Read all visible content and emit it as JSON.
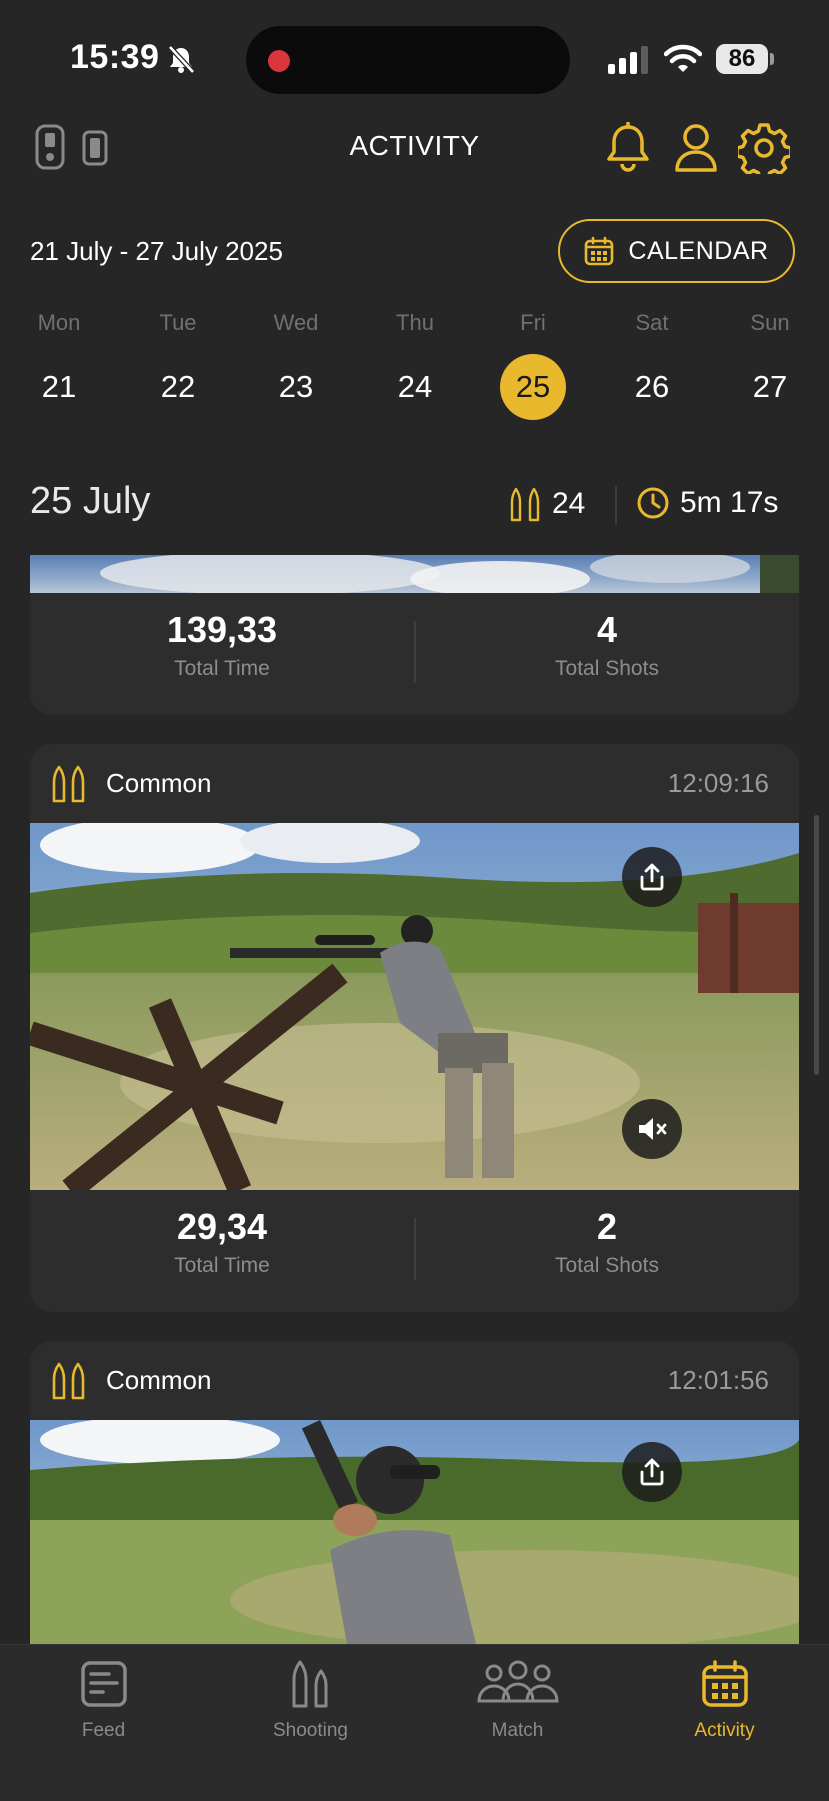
{
  "status_bar": {
    "time": "15:39",
    "battery": "86"
  },
  "header": {
    "title": "ACTIVITY"
  },
  "date_range": "21 July - 27 July 2025",
  "calendar_button": {
    "label": "CALENDAR"
  },
  "week": {
    "day_names": [
      "Mon",
      "Tue",
      "Wed",
      "Thu",
      "Fri",
      "Sat",
      "Sun"
    ],
    "dates": [
      "21",
      "22",
      "23",
      "24",
      "25",
      "26",
      "27"
    ],
    "selected": "25"
  },
  "day_summary": {
    "date": "25 July",
    "shots": "24",
    "duration": "5m 17s"
  },
  "sessions": [
    {
      "total_time": "139,33",
      "total_time_label": "Total Time",
      "total_shots": "4",
      "total_shots_label": "Total Shots"
    },
    {
      "type": "Common",
      "time": "12:09:16",
      "total_time": "29,34",
      "total_time_label": "Total Time",
      "total_shots": "2",
      "total_shots_label": "Total Shots"
    },
    {
      "type": "Common",
      "time": "12:01:56"
    }
  ],
  "nav": [
    {
      "label": "Feed",
      "icon": "feed-icon"
    },
    {
      "label": "Shooting",
      "icon": "bullets-icon"
    },
    {
      "label": "Match",
      "icon": "group-icon"
    },
    {
      "label": "Activity",
      "icon": "calendar-icon"
    }
  ],
  "colors": {
    "accent": "#e8b92d",
    "background": "#262626",
    "card": "#2d2d2d"
  }
}
